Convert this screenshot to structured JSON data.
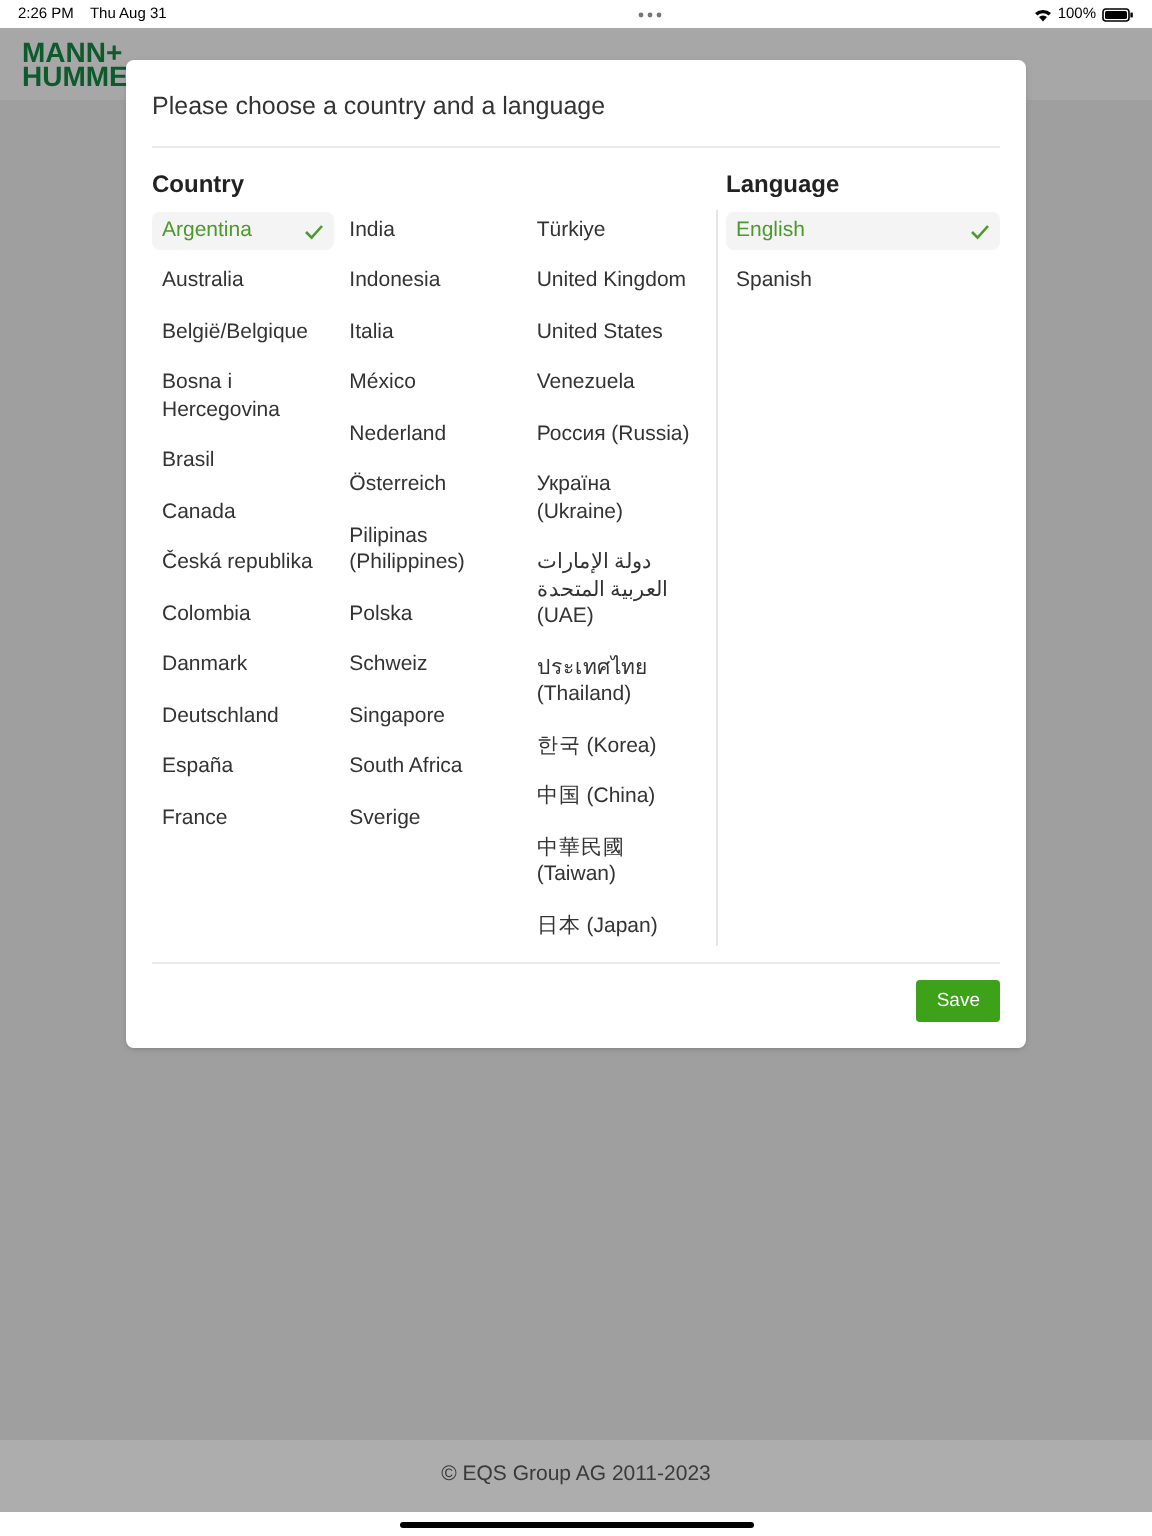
{
  "status_bar": {
    "time": "2:26 PM",
    "date": "Thu Aug 31",
    "battery": "100%"
  },
  "header": {
    "logo_lines": [
      "MANN+",
      "HUMME"
    ]
  },
  "dialog": {
    "title": "Please choose a country and a language",
    "country": {
      "heading": "Country",
      "columns": [
        [
          {
            "label": "Argentina",
            "selected": true
          },
          {
            "label": "Australia",
            "selected": false
          },
          {
            "label": "België/Belgique",
            "selected": false
          },
          {
            "label": "Bosna i Hercegovina",
            "selected": false
          },
          {
            "label": "Brasil",
            "selected": false
          },
          {
            "label": "Canada",
            "selected": false
          },
          {
            "label": "Česká republika",
            "selected": false
          },
          {
            "label": "Colombia",
            "selected": false
          },
          {
            "label": "Danmark",
            "selected": false
          },
          {
            "label": "Deutschland",
            "selected": false
          },
          {
            "label": "España",
            "selected": false
          },
          {
            "label": "France",
            "selected": false
          }
        ],
        [
          {
            "label": "India",
            "selected": false
          },
          {
            "label": "Indonesia",
            "selected": false
          },
          {
            "label": "Italia",
            "selected": false
          },
          {
            "label": "México",
            "selected": false
          },
          {
            "label": "Nederland",
            "selected": false
          },
          {
            "label": "Österreich",
            "selected": false
          },
          {
            "label": "Pilipinas (Philippines)",
            "selected": false
          },
          {
            "label": "Polska",
            "selected": false
          },
          {
            "label": "Schweiz",
            "selected": false
          },
          {
            "label": "Singapore",
            "selected": false
          },
          {
            "label": "South Africa",
            "selected": false
          },
          {
            "label": "Sverige",
            "selected": false
          }
        ],
        [
          {
            "label": "Türkiye",
            "selected": false
          },
          {
            "label": "United Kingdom",
            "selected": false
          },
          {
            "label": "United States",
            "selected": false
          },
          {
            "label": "Venezuela",
            "selected": false
          },
          {
            "label": "Россия (Russia)",
            "selected": false
          },
          {
            "label": "Україна (Ukraine)",
            "selected": false
          },
          {
            "label": "دولة الإمارات العربية المتحدة (UAE)",
            "selected": false
          },
          {
            "label": "ประเทศไทย (Thailand)",
            "selected": false
          },
          {
            "label": "한국 (Korea)",
            "selected": false
          },
          {
            "label": "中国 (China)",
            "selected": false
          },
          {
            "label": "中華民國 (Taiwan)",
            "selected": false
          },
          {
            "label": "日本 (Japan)",
            "selected": false
          }
        ]
      ]
    },
    "language": {
      "heading": "Language",
      "items": [
        {
          "label": "English",
          "selected": true
        },
        {
          "label": "Spanish",
          "selected": false
        }
      ]
    },
    "save_button": "Save"
  },
  "footer": {
    "copyright": "© EQS Group AG 2011-2023"
  }
}
